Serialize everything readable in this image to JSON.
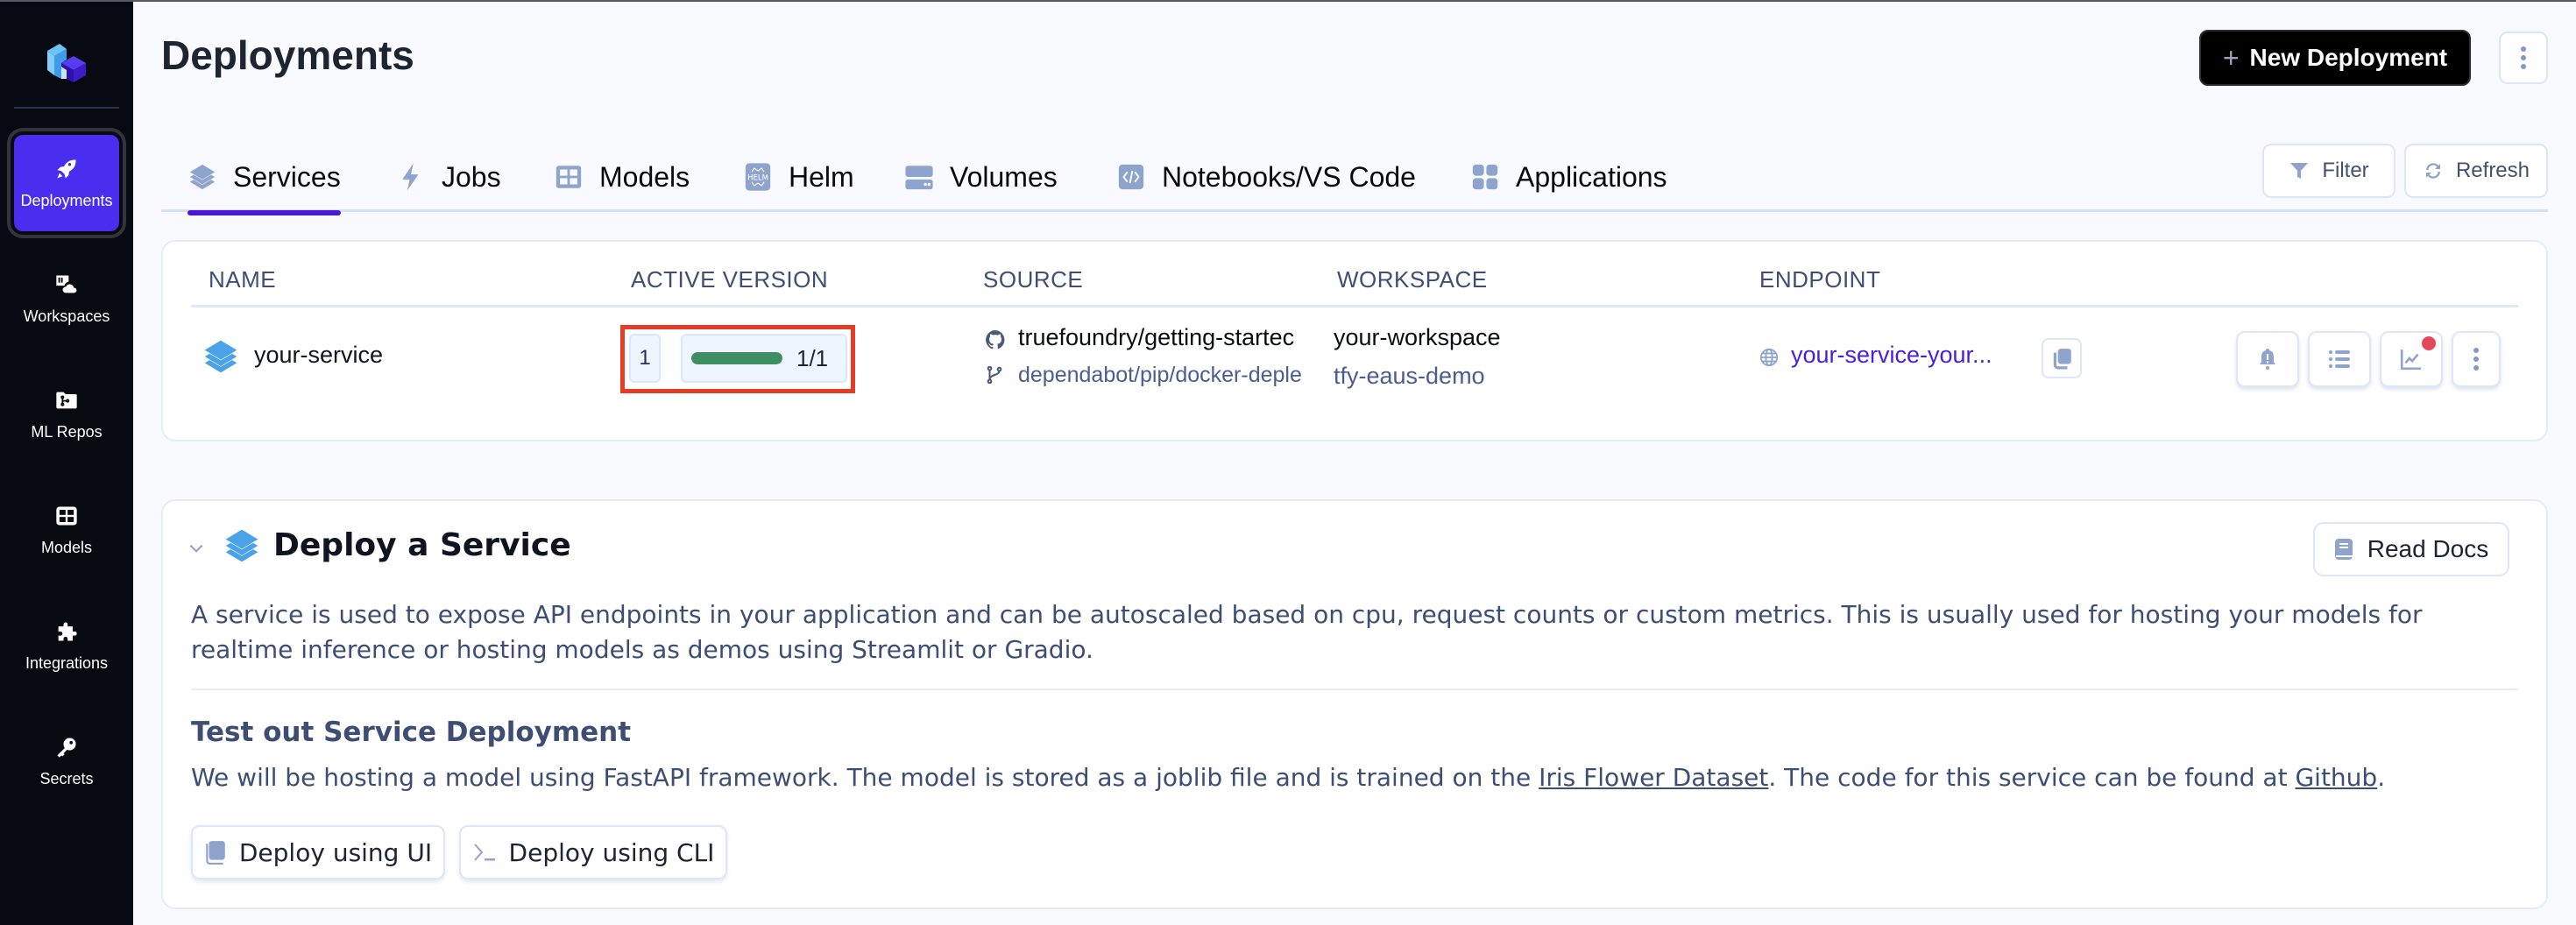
{
  "sidebar": {
    "logo": "truefoundry-logo",
    "items": [
      {
        "label": "Deployments",
        "icon": "rocket-icon",
        "active": true
      },
      {
        "label": "Workspaces",
        "icon": "workspace-cloud-icon",
        "active": false
      },
      {
        "label": "ML Repos",
        "icon": "folder-branch-icon",
        "active": false
      },
      {
        "label": "Models",
        "icon": "grid-icon",
        "active": false
      },
      {
        "label": "Integrations",
        "icon": "puzzle-icon",
        "active": false
      },
      {
        "label": "Secrets",
        "icon": "key-icon",
        "active": false
      }
    ]
  },
  "header": {
    "title": "Deployments",
    "new_button": "New Deployment",
    "new_button_icon": "+"
  },
  "tabs": [
    {
      "label": "Services",
      "icon": "layers-icon",
      "active": true
    },
    {
      "label": "Jobs",
      "icon": "lightning-icon",
      "active": false
    },
    {
      "label": "Models",
      "icon": "grid-icon",
      "active": false
    },
    {
      "label": "Helm",
      "icon": "helm-icon",
      "active": false
    },
    {
      "label": "Volumes",
      "icon": "volume-icon",
      "active": false
    },
    {
      "label": "Notebooks/VS Code",
      "icon": "code-icon",
      "active": false
    },
    {
      "label": "Applications",
      "icon": "apps-icon",
      "active": false
    }
  ],
  "toolbar": {
    "filter_label": "Filter",
    "refresh_label": "Refresh"
  },
  "table": {
    "columns": [
      "NAME",
      "ACTIVE VERSION",
      "SOURCE",
      "WORKSPACE",
      "ENDPOINT"
    ],
    "rows": [
      {
        "name": "your-service",
        "version": "1",
        "replicas_text": "1/1",
        "replicas_ready_fraction": 1.0,
        "source_repo": "truefoundry/getting-startec",
        "source_branch": "dependabot/pip/docker-deple",
        "workspace": "your-workspace",
        "cluster": "tfy-eaus-demo",
        "endpoint": "your-service-your...",
        "metrics_alert": true
      }
    ]
  },
  "deploy_section": {
    "title": "Deploy a Service",
    "read_docs": "Read Docs",
    "description": "A service is used to expose API endpoints in your application and can be autoscaled based on cpu, request counts or custom metrics. This is usually used for hosting your models for realtime inference or hosting models as demos using Streamlit or Gradio.",
    "test_title": "Test out Service Deployment",
    "test_text_1": "We will be hosting a model using FastAPI framework. The model is stored as a joblib file and is trained on the ",
    "test_link_1": "Iris Flower Dataset",
    "test_text_2": ". The code for this service can be found at ",
    "test_link_2": "Github",
    "test_text_3": ".",
    "deploy_ui": "Deploy using UI",
    "deploy_cli": "Deploy using CLI"
  },
  "colors": {
    "accent": "#4a2ef0",
    "tab_underline": "#4a16d8",
    "healthy": "#3d8f62",
    "alert": "#e2485a",
    "highlight_box": "#e63b24",
    "endpoint_link": "#4a1ee0"
  }
}
